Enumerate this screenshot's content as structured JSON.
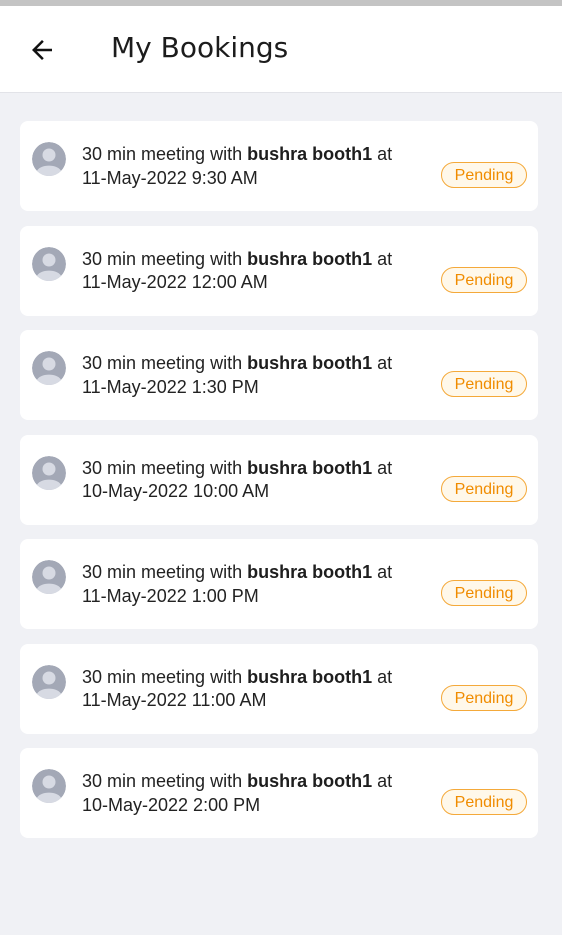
{
  "header": {
    "title": "My Bookings",
    "back_icon": "arrow-left-icon"
  },
  "colors": {
    "background": "#f0f1f5",
    "card": "#ffffff",
    "pending_text": "#f08c00",
    "pending_border": "#f4a93a"
  },
  "bookings": [
    {
      "prefix": "30 min meeting with ",
      "name": "bushra booth1",
      "suffix": " at",
      "datetime": "11-May-2022 9:30 AM",
      "status": "Pending"
    },
    {
      "prefix": "30 min meeting with ",
      "name": "bushra booth1",
      "suffix": " at",
      "datetime": "11-May-2022 12:00 AM",
      "status": "Pending"
    },
    {
      "prefix": "30 min meeting with ",
      "name": "bushra booth1",
      "suffix": " at",
      "datetime": "11-May-2022 1:30 PM",
      "status": "Pending"
    },
    {
      "prefix": "30 min meeting with ",
      "name": "bushra booth1",
      "suffix": " at",
      "datetime": "10-May-2022 10:00 AM",
      "status": "Pending"
    },
    {
      "prefix": "30 min meeting with ",
      "name": "bushra booth1",
      "suffix": " at",
      "datetime": "11-May-2022 1:00 PM",
      "status": "Pending"
    },
    {
      "prefix": "30 min meeting with ",
      "name": "bushra booth1",
      "suffix": " at",
      "datetime": "11-May-2022 11:00 AM",
      "status": "Pending"
    },
    {
      "prefix": "30 min meeting with ",
      "name": "bushra booth1",
      "suffix": " at",
      "datetime": "10-May-2022 2:00 PM",
      "status": "Pending"
    }
  ]
}
